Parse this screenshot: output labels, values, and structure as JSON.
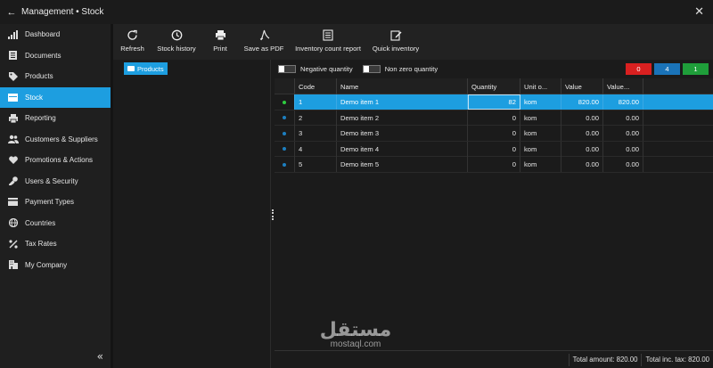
{
  "window": {
    "title": "Management • Stock"
  },
  "sidebar": {
    "items": [
      {
        "label": "Dashboard",
        "icon": "bar-chart-icon"
      },
      {
        "label": "Documents",
        "icon": "document-icon"
      },
      {
        "label": "Products",
        "icon": "tag-icon"
      },
      {
        "label": "Stock",
        "icon": "stock-box-icon",
        "active": true
      },
      {
        "label": "Reporting",
        "icon": "printer-icon"
      },
      {
        "label": "Customers & Suppliers",
        "icon": "users-icon"
      },
      {
        "label": "Promotions & Actions",
        "icon": "heart-icon"
      },
      {
        "label": "Users & Security",
        "icon": "key-icon"
      },
      {
        "label": "Payment Types",
        "icon": "credit-card-icon"
      },
      {
        "label": "Countries",
        "icon": "globe-icon"
      },
      {
        "label": "Tax Rates",
        "icon": "percent-icon"
      },
      {
        "label": "My Company",
        "icon": "building-icon"
      }
    ]
  },
  "toolbar": {
    "buttons": [
      {
        "label": "Refresh",
        "icon": "refresh-icon"
      },
      {
        "label": "Stock history",
        "icon": "clock-icon"
      },
      {
        "label": "Print",
        "icon": "printer-icon"
      },
      {
        "label": "Save as PDF",
        "icon": "pdf-icon"
      },
      {
        "label": "Inventory count report",
        "icon": "report-icon"
      },
      {
        "label": "Quick inventory",
        "icon": "edit-icon"
      }
    ]
  },
  "tree": {
    "root": "Products"
  },
  "filters": {
    "negative_quantity": "Negative quantity",
    "non_zero_quantity": "Non zero quantity",
    "badges": [
      {
        "value": "0",
        "color": "#d92020"
      },
      {
        "value": "4",
        "color": "#1a73b8"
      },
      {
        "value": "1",
        "color": "#1f9e3a"
      }
    ]
  },
  "table": {
    "headers": [
      "Code",
      "Name",
      "Quantity",
      "Unit o...",
      "Value",
      "Value..."
    ],
    "rows": [
      {
        "code": "1",
        "name": "Demo item 1",
        "quantity": "82",
        "unit": "kom",
        "value": "820.00",
        "value_tax": "820.00",
        "status": "green",
        "selected": true
      },
      {
        "code": "2",
        "name": "Demo item 2",
        "quantity": "0",
        "unit": "kom",
        "value": "0.00",
        "value_tax": "0.00",
        "status": "blue"
      },
      {
        "code": "3",
        "name": "Demo item 3",
        "quantity": "0",
        "unit": "kom",
        "value": "0.00",
        "value_tax": "0.00",
        "status": "blue"
      },
      {
        "code": "4",
        "name": "Demo item 4",
        "quantity": "0",
        "unit": "kom",
        "value": "0.00",
        "value_tax": "0.00",
        "status": "blue"
      },
      {
        "code": "5",
        "name": "Demo item 5",
        "quantity": "0",
        "unit": "kom",
        "value": "0.00",
        "value_tax": "0.00",
        "status": "blue"
      }
    ]
  },
  "footer": {
    "total_amount": "Total amount: 820.00",
    "total_inc_tax": "Total inc. tax: 820.00"
  },
  "watermark": {
    "arabic": "مستقل",
    "latin": "mostaql.com"
  }
}
